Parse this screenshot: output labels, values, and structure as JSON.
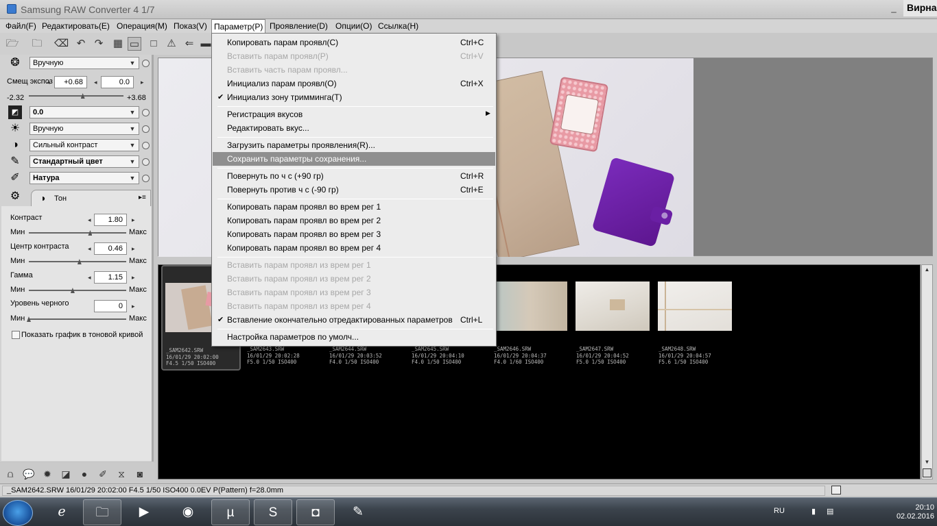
{
  "window": {
    "title": "Samsung RAW Converter 4   1/7",
    "user_label": "Вирна",
    "controls": [
      "_",
      "□"
    ]
  },
  "menubar": {
    "items": [
      {
        "label": "Файл(F)"
      },
      {
        "label": "Редактировать(E)"
      },
      {
        "label": "Операция(M)"
      },
      {
        "label": "Показ(V)"
      },
      {
        "label": "Параметр(P)"
      },
      {
        "label": "Проявление(D)"
      },
      {
        "label": "Опции(O)"
      },
      {
        "label": "Ссылка(H)"
      }
    ]
  },
  "toolbar": {
    "icons": [
      "open-folder-icon",
      "open-file-icon",
      "eraser-icon",
      "undo-icon",
      "redo-icon",
      "grid-view-icon",
      "single-view-icon",
      "frame-icon",
      "warning-icon",
      "back-icon",
      "monitor-icon"
    ]
  },
  "left_panel": {
    "white_balance_select": "Вручную",
    "exposure_label": "Смещ экспоз",
    "exposure_value": "+0.68",
    "exposure_value2": "0.0",
    "exposure_min": "-2.32",
    "exposure_max": "+3.68",
    "exposure_level": 0.57,
    "brightness_select": "0.0",
    "tone_select": "Вручную",
    "contrast_select": "Сильный контраст",
    "color_select": "Стандартный цвет",
    "film_select": "Натура",
    "tab_label": "Тон",
    "tone": {
      "contrast_label": "Контраст",
      "contrast_value": "1.80",
      "contrast_level": 0.63,
      "center_label": "Центр контраста",
      "center_value": "0.46",
      "center_level": 0.52,
      "gamma_label": "Гамма",
      "gamma_value": "1.15",
      "gamma_level": 0.45,
      "black_label": "Уровень черного",
      "black_value": "0",
      "black_level": 0.0,
      "min_label": "Мин",
      "max_label": "Макс",
      "show_graph_label": "Показать график в тоновой кривой",
      "show_graph_checked": false
    }
  },
  "filmstrip": {
    "thumbnails": [
      {
        "name": "_SAM2642.SRW",
        "date": "16/01/29 20:02:00",
        "exif": "F4.5 1/50 ISO400",
        "selected": true,
        "color": "#c9b29a"
      },
      {
        "name": "_SAM2643.SRW",
        "date": "16/01/29 20:02:28",
        "exif": "F5.0 1/50 ISO400",
        "selected": false,
        "color": "#c4ae96"
      },
      {
        "name": "_SAM2644.SRW",
        "date": "16/01/29 20:03:52",
        "exif": "F4.0 1/50 ISO400",
        "selected": false,
        "color": "#cfc2b2"
      },
      {
        "name": "_SAM2645.SRW",
        "date": "16/01/29 20:04:10",
        "exif": "F4.0 1/50 ISO400",
        "selected": false,
        "color": "#d6cbbd"
      },
      {
        "name": "_SAM2646.SRW",
        "date": "16/01/29 20:04:37",
        "exif": "F4.0 1/60 ISO400",
        "selected": false,
        "color": "#bfc9c8"
      },
      {
        "name": "_SAM2647.SRW",
        "date": "16/01/29 20:04:52",
        "exif": "F5.0 1/50 ISO400",
        "selected": false,
        "color": "#dfdcd6"
      },
      {
        "name": "_SAM2648.SRW",
        "date": "16/01/29 20:04:57",
        "exif": "F5.6 1/50 ISO400",
        "selected": false,
        "color": "#e4e1dc"
      }
    ]
  },
  "statusbar": {
    "text": "_SAM2642.SRW 16/01/29 20:02:00 F4.5 1/50 ISO400  0.0EV P(Pattern) f=28.0mm"
  },
  "dropdown": {
    "items": [
      {
        "label": "Копировать парам проявл(C)",
        "shortcut": "Ctrl+C"
      },
      {
        "label": "Вставить парам проявл(P)",
        "shortcut": "Ctrl+V",
        "disabled": true
      },
      {
        "label": "Вставить часть парам проявл...",
        "disabled": true
      },
      {
        "label": "Инициализ парам проявл(O)",
        "shortcut": "Ctrl+X"
      },
      {
        "label": "Инициализ зону тримминга(T)",
        "checked": true
      },
      {
        "label": "Регистрация вкусов",
        "submenu": true
      },
      {
        "label": "Редактировать вкус..."
      },
      {
        "label": "Загрузить параметры проявления(R)..."
      },
      {
        "label": "Сохранить параметры сохранения...",
        "highlighted": true
      },
      {
        "label": "Повернуть по ч с (+90 гр)",
        "shortcut": "Ctrl+R"
      },
      {
        "label": "Повернуть против ч с (-90 гр)",
        "shortcut": "Ctrl+E"
      },
      {
        "label": "Копировать парам проявл во врем рег 1"
      },
      {
        "label": "Копировать парам проявл во врем рег 2"
      },
      {
        "label": "Копировать парам проявл во врем рег 3"
      },
      {
        "label": "Копировать парам проявл во врем рег 4"
      },
      {
        "label": "Вставить парам проявл из врем рег 1",
        "disabled": true
      },
      {
        "label": "Вставить парам проявл из врем рег 2",
        "disabled": true
      },
      {
        "label": "Вставить парам проявл из врем рег 3",
        "disabled": true
      },
      {
        "label": "Вставить парам проявл из врем рег 4",
        "disabled": true
      },
      {
        "label": "Вставление окончательно отредактированных параметров",
        "shortcut": "Ctrl+L",
        "checked": true
      },
      {
        "label": "Настройка параметров по умолч..."
      }
    ]
  },
  "taskbar": {
    "language": "RU",
    "time": "20:10",
    "date": "02.02.2016",
    "apps": [
      "explorer-icon",
      "internet-explorer-icon",
      "folder-icon",
      "media-player-icon",
      "chrome-icon",
      "utorrent-icon",
      "skype-icon",
      "camera-icon",
      "paint-icon"
    ]
  }
}
